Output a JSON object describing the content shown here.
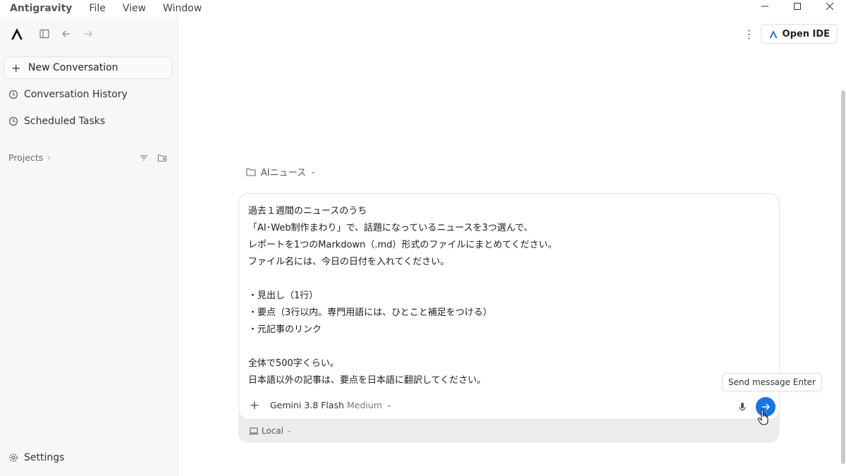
{
  "menu": [
    "Antigravity",
    "File",
    "View",
    "Window"
  ],
  "sidebar": {
    "new_conversation": "New Conversation",
    "conversation_history": "Conversation History",
    "scheduled_tasks": "Scheduled Tasks",
    "projects": "Projects",
    "settings": "Settings"
  },
  "header": {
    "open_ide": "Open IDE"
  },
  "composer": {
    "folder": "AIニュース",
    "message": "過去１週間のニュースのうち\n「AI･Web制作まわり」で、話題になっているニュースを3つ選んで、\nレポートを1つのMarkdown（.md）形式のファイルにまとめてください。\nファイル名には、今日の日付を入れてください。\n\n・見出し（1行）\n・要点（3行以内。専門用語には、ひとこと補足をつける）\n・元記事のリンク\n\n全体で500字くらい。\n日本語以外の記事は、要点を日本語に翻訳してください。",
    "model_name": "Gemini 3.8 Flash",
    "model_tier": "Medium",
    "environment": "Local",
    "send_tooltip": "Send message Enter"
  },
  "colors": {
    "accent": "#1a73e8",
    "sidebar_bg": "#f7f7f7"
  },
  "icons": [
    "antigravity-logo-icon",
    "sidebar-toggle-icon",
    "back-arrow-icon",
    "forward-arrow-icon",
    "plus-icon",
    "history-icon",
    "clock-icon",
    "filter-icon",
    "new-folder-icon",
    "kebab-menu-icon",
    "folder-icon",
    "microphone-icon",
    "send-arrow-icon",
    "laptop-icon",
    "gear-icon"
  ]
}
